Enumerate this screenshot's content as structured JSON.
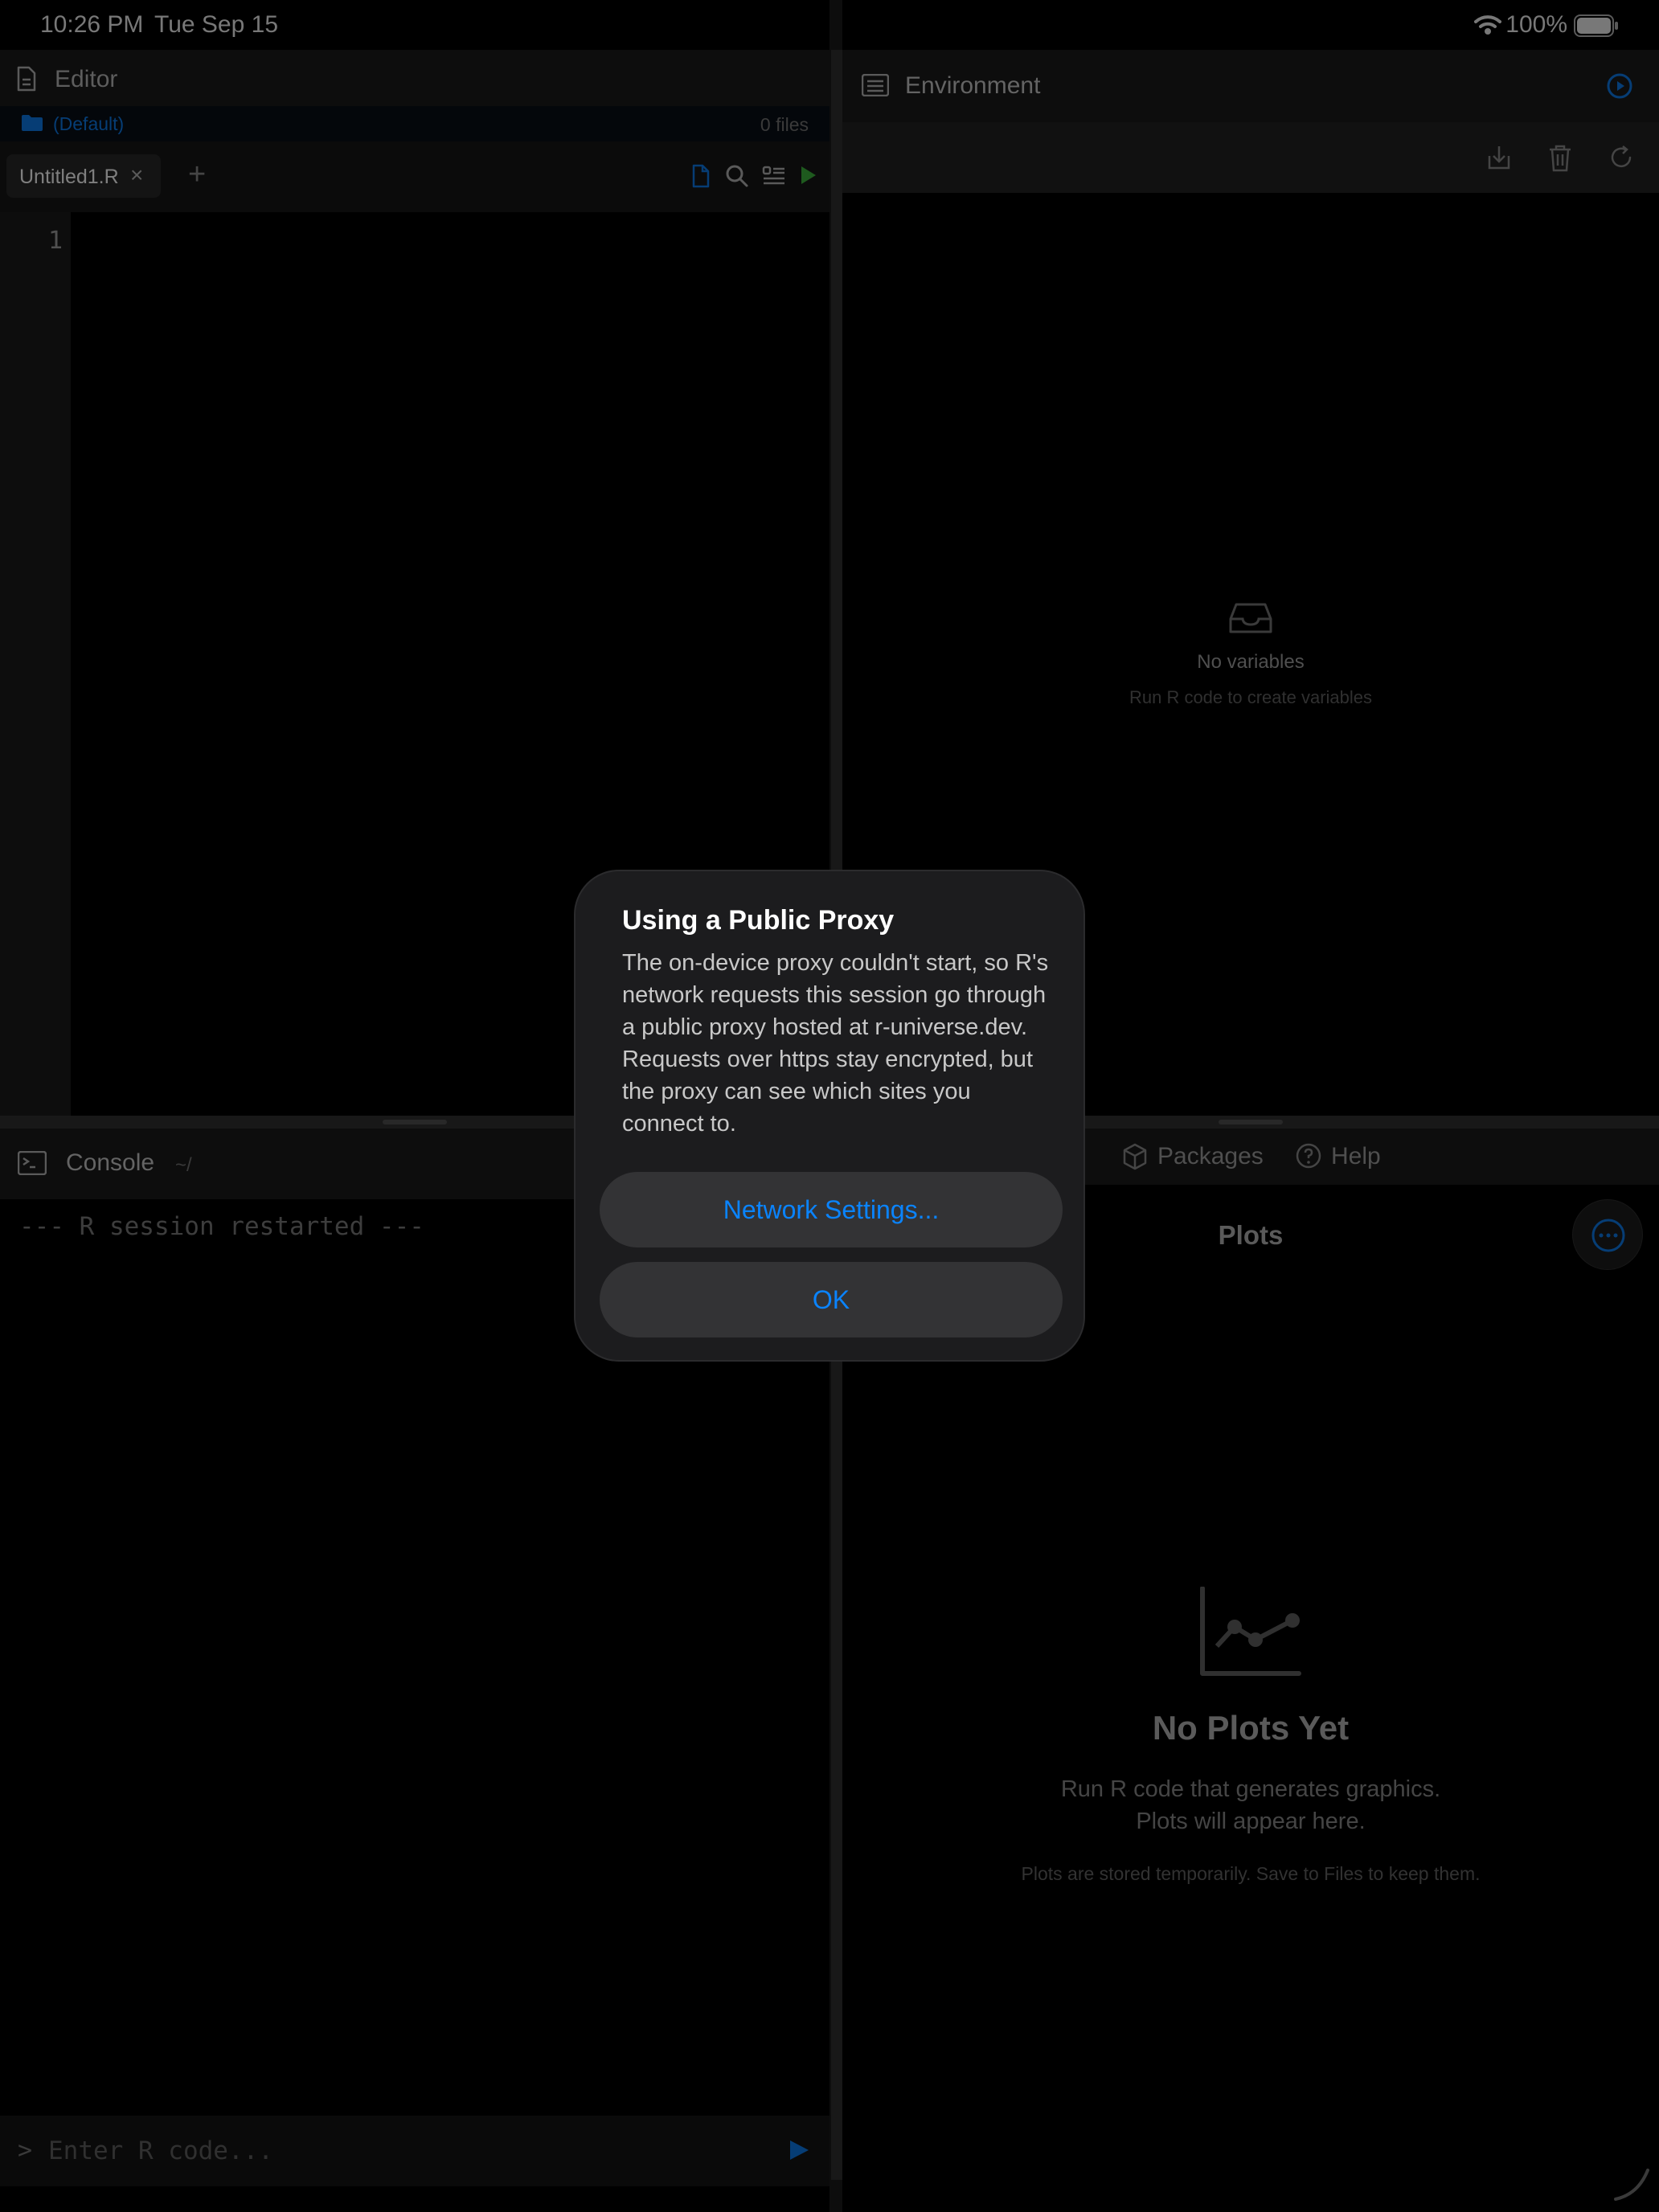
{
  "status_bar": {
    "time": "10:26 PM",
    "date": "Tue Sep 15",
    "battery": "100%"
  },
  "editor": {
    "title": "Editor",
    "project_name": "(Default)",
    "file_count": "0 files",
    "tab_label": "Untitled1.R",
    "tab_close": "×",
    "add_tab": "+",
    "line_number": "1"
  },
  "environment": {
    "title": "Environment",
    "empty_title": "No variables",
    "empty_subtitle": "Run R code to create variables"
  },
  "console": {
    "title": "Console",
    "path": "~/",
    "output_line": "--- R session restarted ---",
    "prompt": ">",
    "input_placeholder": "Enter R code..."
  },
  "right_bottom": {
    "tabs": [
      {
        "label": "Packages"
      },
      {
        "label": "Help"
      }
    ],
    "plots_title": "Plots",
    "empty_title": "No Plots Yet",
    "empty_line1": "Run R code that generates graphics.",
    "empty_line2": "Plots will appear here.",
    "footnote": "Plots are stored temporarily. Save to Files to keep them."
  },
  "dialog": {
    "title": "Using a Public Proxy",
    "message": "The on-device proxy couldn't start, so R's network requests this session go through a public proxy hosted at r-universe.dev. Requests over https stay encrypted, but the proxy can see which sites you connect to.",
    "primary_button": "Network Settings...",
    "ok_button": "OK"
  },
  "colors": {
    "accent": "#0a84ff",
    "run_green": "#2e8b2e",
    "background": "#000000",
    "panel": "#141414"
  }
}
